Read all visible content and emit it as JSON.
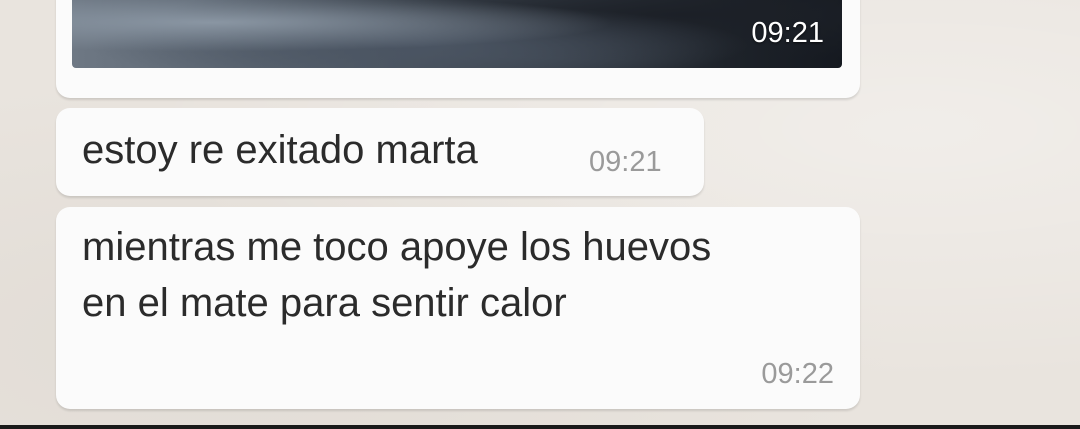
{
  "chat": {
    "messages": [
      {
        "type": "image",
        "time": "09:21"
      },
      {
        "type": "text",
        "text": "estoy re exitado marta",
        "time": "09:21"
      },
      {
        "type": "text",
        "text": "mientras me toco apoye los huevos en el mate para sentir calor",
        "time": "09:22"
      }
    ]
  },
  "colors": {
    "background": "#e9e4de",
    "bubble": "#fbfbfb",
    "message_text": "#2b2b2b",
    "timestamp": "#9a9a9a"
  }
}
